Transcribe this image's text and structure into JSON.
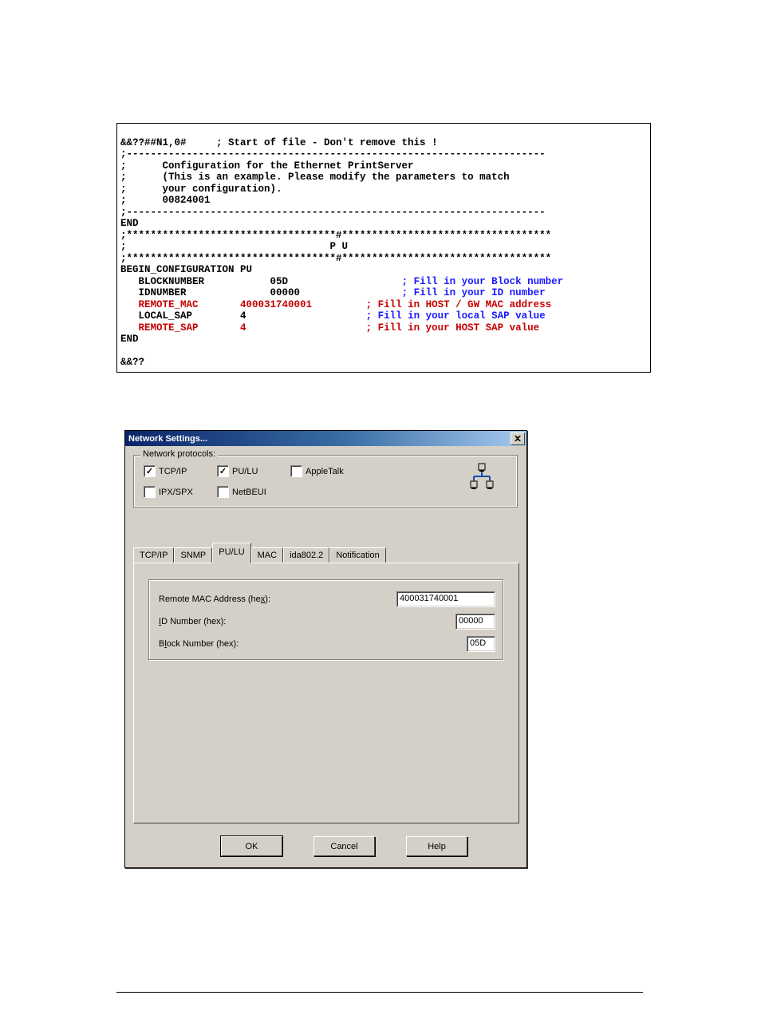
{
  "code": {
    "l1": "&&??##N1,0#     ; Start of file - Don't remove this !",
    "l2": ";----------------------------------------------------------------------",
    "l3": ";      Configuration for the Ethernet PrintServer",
    "l4": ";      (This is an example. Please modify the parameters to match",
    "l5": ";      your configuration).",
    "l6": ";      00824001",
    "l7": ";----------------------------------------------------------------------",
    "l8": "END",
    "l9": ";***********************************#***********************************",
    "l10": ";                                  P U",
    "l11": ";***********************************#***********************************",
    "l12": "BEGIN_CONFIGURATION PU",
    "l13a": "   BLOCKNUMBER           05D                   ",
    "l13b": "; Fill in your Block number",
    "l14a": "   IDNUMBER              00000                 ",
    "l14b": "; Fill in your ID number",
    "l15a": "   REMOTE_MAC       400031740001         ",
    "l15b": "; Fill in HOST / GW MAC address",
    "l16a": "   LOCAL_SAP        4                    ",
    "l16b": "; Fill in your local SAP value",
    "l17a": "   REMOTE_SAP       4                    ",
    "l17b": "; Fill in your HOST SAP value",
    "l18": "END",
    "l19": "",
    "l20": "&&??"
  },
  "dialog": {
    "title": "Network Settings...",
    "group_label": "Network protocols:",
    "checks": {
      "tcpip": "TCP/IP",
      "pulu": "PU/LU",
      "appletalk": "AppleTalk",
      "ipxspx": "IPX/SPX",
      "netbeui": "NetBEUI"
    },
    "tabs": {
      "tcpip": "TCP/IP",
      "snmp": "SNMP",
      "pulu": "PU/LU",
      "mac": "MAC",
      "ida": "ida802.2",
      "notif": "Notification"
    },
    "fields": {
      "remote_mac_label_pre": "Remote MAC Address (he",
      "remote_mac_label_u": "x",
      "remote_mac_label_post": "):",
      "remote_mac_value": "400031740001",
      "id_label_u": "I",
      "id_label_post": "D Number (hex):",
      "id_value": "00000",
      "block_label_pre": "B",
      "block_label_u": "l",
      "block_label_post": "ock Number (hex):",
      "block_value": "05D"
    },
    "buttons": {
      "ok": "OK",
      "cancel": "Cancel",
      "help": "Help"
    }
  }
}
